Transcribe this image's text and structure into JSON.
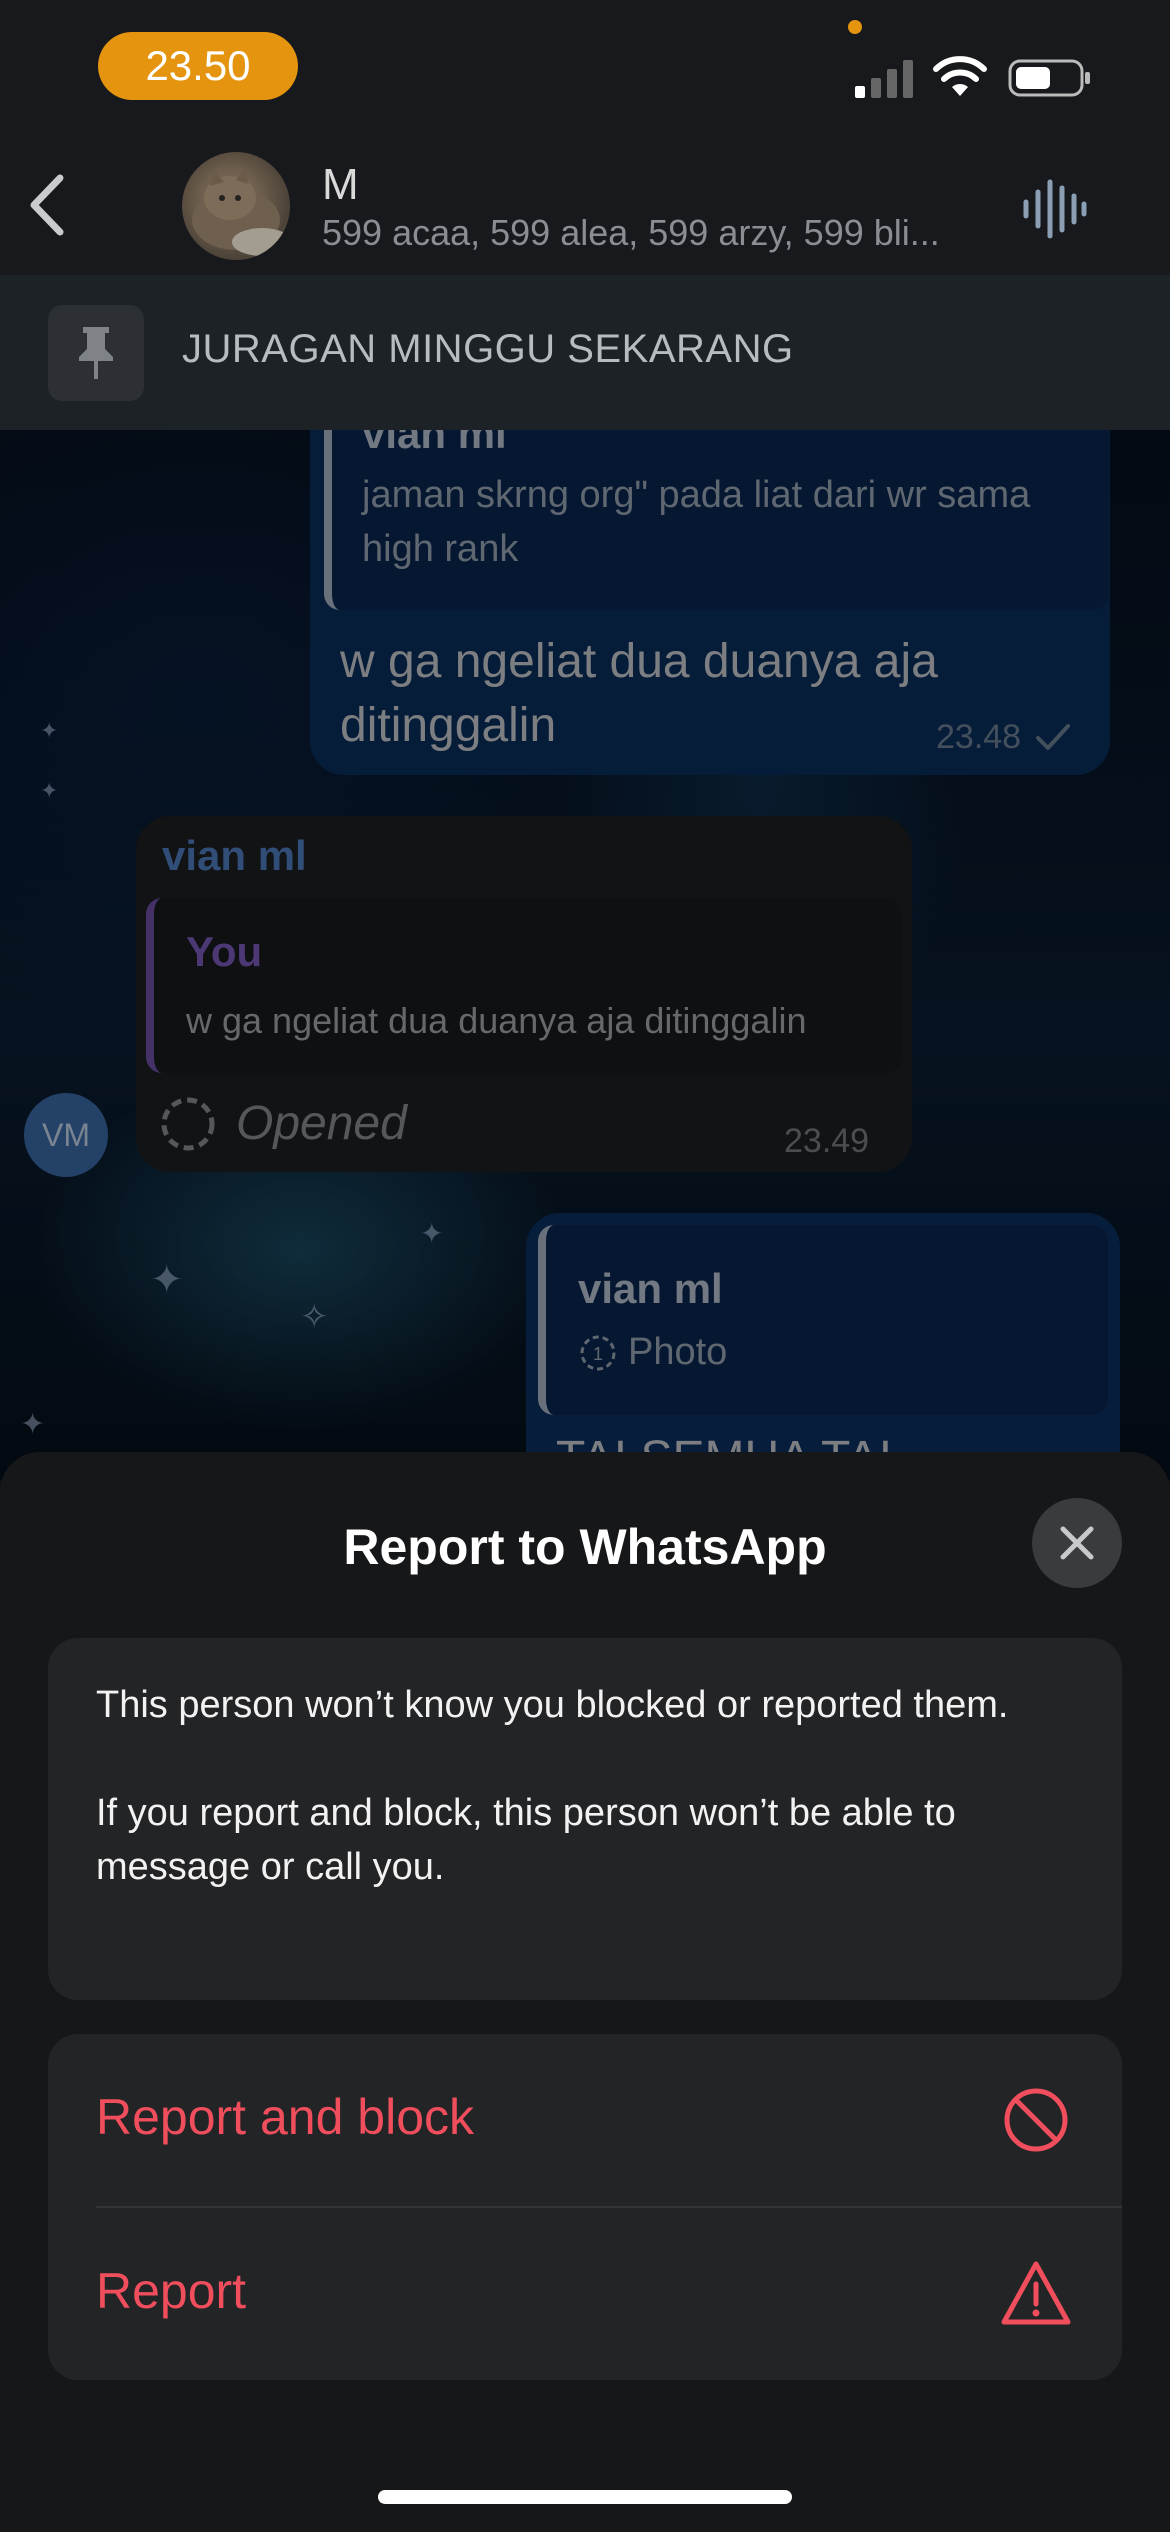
{
  "status_bar": {
    "time": "23.50"
  },
  "header": {
    "name": "M",
    "members": "599 acaa, 599 alea, 599 arzy, 599 bli..."
  },
  "pinned": {
    "text": "JURAGAN MINGGU SEKARANG"
  },
  "messages": [
    {
      "direction": "out",
      "quote_author": "vian ml",
      "quote_text": "jaman skrng org\" pada liat dari wr sama high rank",
      "text": "w ga ngeliat dua duanya aja ditinggalin",
      "time": "23.48"
    },
    {
      "direction": "in",
      "sender": "vian ml",
      "quote_author": "You",
      "quote_text": "w ga ngeliat dua duanya aja ditinggalin",
      "text": "Opened",
      "time": "23.49",
      "avatar_initials": "VM"
    },
    {
      "direction": "out",
      "quote_author": "vian ml",
      "quote_text": "Photo",
      "text": "TAI SEMUA TAI"
    }
  ],
  "sheet": {
    "title": "Report to WhatsApp",
    "info_line1": "This person won’t know you blocked or reported them.",
    "info_line2": "If you report and block, this person won’t be able to message or call you.",
    "actions": [
      {
        "label": "Report and block",
        "icon": "block-icon"
      },
      {
        "label": "Report",
        "icon": "warning-icon"
      }
    ]
  },
  "colors": {
    "accent_orange": "#e4940f",
    "destructive_red": "#f04e5c",
    "outgoing_bubble": "#0b2f5c",
    "sender_blue": "#4f7fc4",
    "you_purple": "#7d5bbf"
  }
}
